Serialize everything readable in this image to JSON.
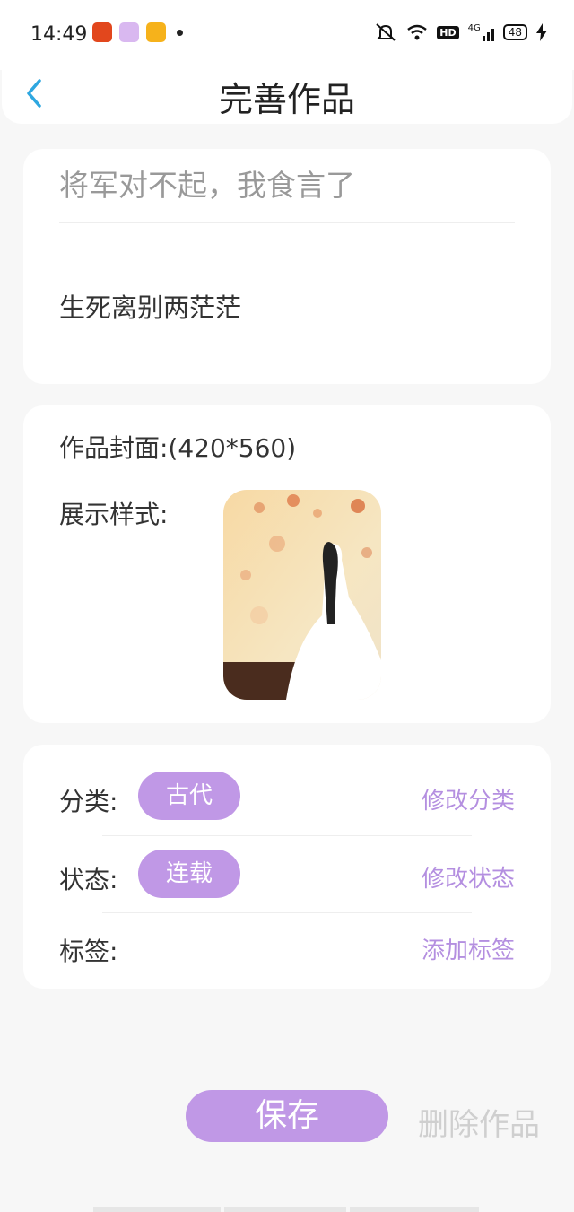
{
  "status_bar": {
    "time": "14:49",
    "app_icons": [
      "app-red-icon",
      "app-purple-icon",
      "weibo-icon"
    ],
    "network": "4G",
    "hd_label": "HD",
    "battery": "48"
  },
  "nav": {
    "title": "完善作品",
    "back_icon": "chevron-left-icon"
  },
  "work": {
    "title_placeholder": "将军对不起，我食言了",
    "subtitle": "生死离别两茫茫"
  },
  "cover": {
    "label": "作品封面:(420*560)",
    "display_label": "展示样式:"
  },
  "meta": {
    "category_label": "分类:",
    "category_value": "古代",
    "category_action": "修改分类",
    "status_label": "状态:",
    "status_value": "连载",
    "status_action": "修改状态",
    "tags_label": "标签:",
    "tags_action": "添加标签"
  },
  "footer": {
    "save_label": "保存",
    "delete_label": "删除作品"
  },
  "colors": {
    "accent": "#c098e6",
    "action_text": "#b48fe0",
    "back_arrow": "#2ea7e0",
    "background": "#f7f7f7"
  }
}
